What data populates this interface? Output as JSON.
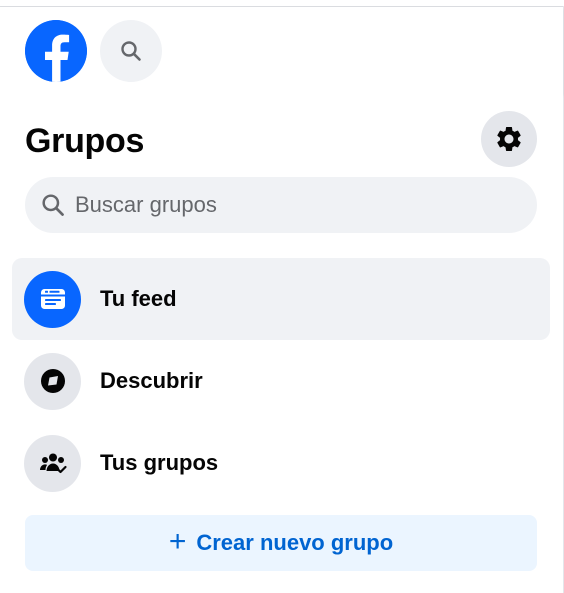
{
  "brand": {
    "logo_icon": "facebook-logo-icon",
    "color": "#0866ff"
  },
  "header": {
    "search_icon": "search-icon"
  },
  "groups": {
    "title": "Grupos",
    "settings_icon": "gear-icon",
    "search": {
      "placeholder": "Buscar grupos",
      "value": ""
    },
    "nav": [
      {
        "label": "Tu feed",
        "icon": "feed-icon",
        "active": true
      },
      {
        "label": "Descubrir",
        "icon": "compass-icon",
        "active": false
      },
      {
        "label": "Tus grupos",
        "icon": "groups-icon",
        "active": false
      }
    ],
    "create_button": {
      "label": "Crear nuevo grupo",
      "icon": "plus-icon"
    }
  },
  "colors": {
    "accent": "#0866ff",
    "accent_text": "#0064d1",
    "accent_soft": "#ebf5ff",
    "surface": "#f0f2f5",
    "icon_bg": "#e4e6eb",
    "text_primary": "#050505",
    "text_secondary": "#65676b"
  }
}
